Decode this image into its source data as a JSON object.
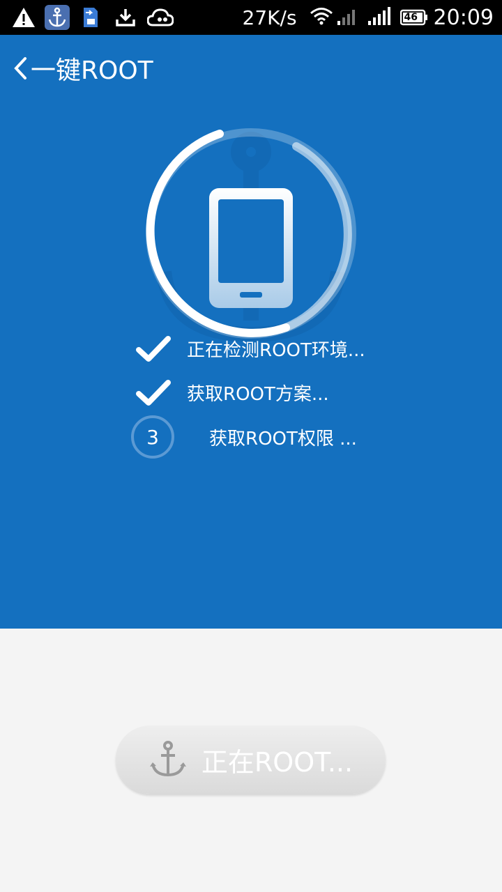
{
  "status_bar": {
    "icons": [
      "warning-icon",
      "anchor-app-icon",
      "sim-transfer-icon",
      "download-icon",
      "cloud-icon"
    ],
    "speed": "27K/s",
    "network": "46",
    "time": "20:09"
  },
  "header": {
    "title": "一键ROOT"
  },
  "steps": [
    {
      "state": "done",
      "label": "正在检测ROOT环境..."
    },
    {
      "state": "done",
      "label": "获取ROOT方案..."
    },
    {
      "state": "active",
      "number": "3",
      "label": "获取ROOT权限 ..."
    }
  ],
  "button": {
    "label": "正在ROOT...",
    "icon": "anchor-icon"
  },
  "colors": {
    "primary": "#1470bf",
    "background": "#f4f4f4"
  }
}
